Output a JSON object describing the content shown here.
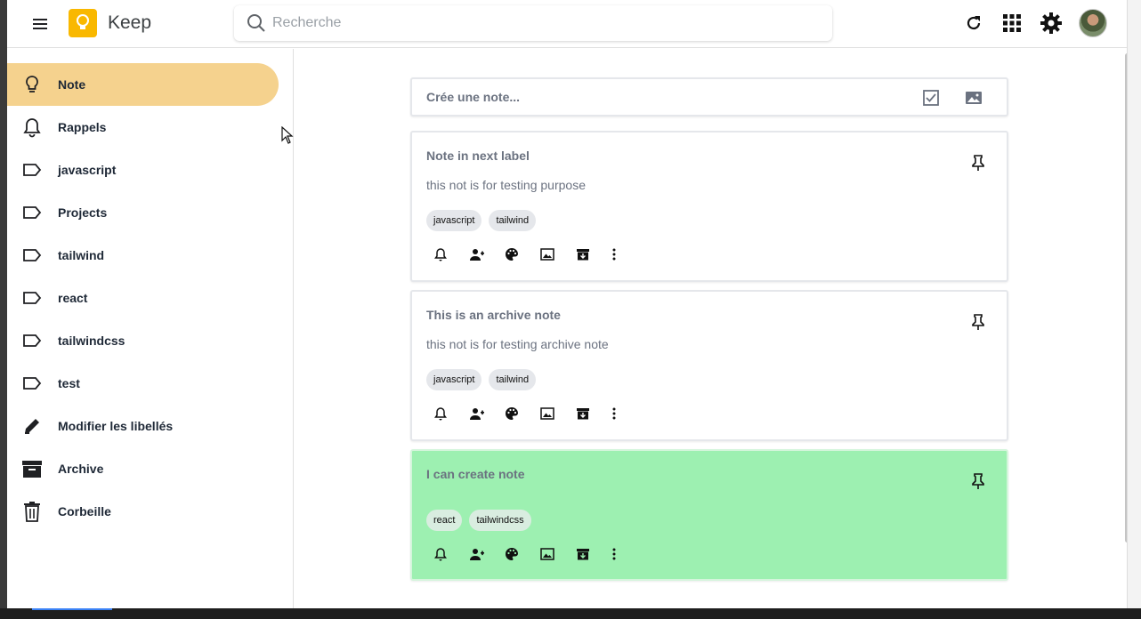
{
  "header": {
    "app_title": "Keep",
    "search_placeholder": "Recherche"
  },
  "sidebar": {
    "items": [
      {
        "label": "Note",
        "icon": "lightbulb-icon",
        "active": true
      },
      {
        "label": "Rappels",
        "icon": "bell-icon"
      },
      {
        "label": "javascript",
        "icon": "label-icon"
      },
      {
        "label": "Projects",
        "icon": "label-icon"
      },
      {
        "label": "tailwind",
        "icon": "label-icon"
      },
      {
        "label": "react",
        "icon": "label-icon"
      },
      {
        "label": "tailwindcss",
        "icon": "label-icon"
      },
      {
        "label": "test",
        "icon": "label-icon"
      },
      {
        "label": "Modifier les libellés",
        "icon": "pencil-icon"
      },
      {
        "label": "Archive",
        "icon": "archive-icon"
      },
      {
        "label": "Corbeille",
        "icon": "trash-icon"
      }
    ]
  },
  "create": {
    "placeholder": "Crée une note..."
  },
  "notes": [
    {
      "title": "Note in next label",
      "body": "this not is for testing purpose",
      "tags": [
        "javascript",
        "tailwind"
      ],
      "color": "#ffffff"
    },
    {
      "title": "This is an archive note",
      "body": "this not is for testing archive note",
      "tags": [
        "javascript",
        "tailwind"
      ],
      "color": "#ffffff"
    },
    {
      "title": "I can create note",
      "body": "",
      "tags": [
        "react",
        "tailwindcss"
      ],
      "color": "#9df0b1"
    }
  ],
  "colors": {
    "active_nav": "#f5d28e",
    "logo": "#f9b800",
    "green_note": "#9df0b1"
  }
}
